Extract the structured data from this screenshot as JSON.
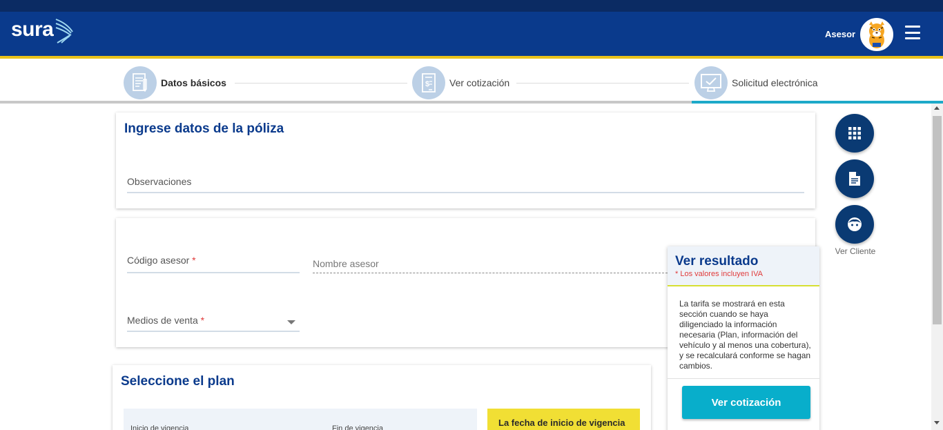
{
  "header": {
    "logo": "sura",
    "user_role": "Asesor",
    "menu_icon": "hamburger-menu-icon"
  },
  "stepper": {
    "steps": [
      {
        "label": "Datos básicos",
        "icon": "document-edit-icon",
        "active": true
      },
      {
        "label": "Ver cotización",
        "icon": "invoice-dollar-icon",
        "active": false
      },
      {
        "label": "Solicitud electrónica",
        "icon": "computer-monitor-icon",
        "active": false
      }
    ]
  },
  "policy_card": {
    "title": "Ingrese datos de la póliza",
    "observations_label": "Observaciones"
  },
  "advisor_card": {
    "code_label": "Código asesor",
    "code_required": "*",
    "name_placeholder": "Nombre asesor",
    "sales_channel_label": "Medios de venta",
    "sales_channel_required": "*"
  },
  "plan_card": {
    "title": "Seleccione el plan",
    "start_date_label": "Inicio de vigencia",
    "end_date_label": "Fin de vigencia",
    "notice": "La fecha de inicio de vigencia"
  },
  "side_actions": {
    "items": [
      {
        "icon": "apps-grid-icon"
      },
      {
        "icon": "document-icon"
      },
      {
        "icon": "face-icon",
        "caption": "Ver Cliente"
      }
    ]
  },
  "result_panel": {
    "title": "Ver resultado",
    "note": "* Los valores incluyen IVA",
    "body": "La tarifa se mostrará en esta sección cuando se haya diligenciado la información necesaria (Plan, información del vehículo y al menos una cobertura), y se recalculará conforme se hagan cambios.",
    "button_label": "Ver cotización"
  },
  "colors": {
    "header_blue": "#0a3a8c",
    "accent_yellow": "#e9c21b",
    "accent_cyan": "#08aecb",
    "fab_navy": "#0a3a73"
  }
}
